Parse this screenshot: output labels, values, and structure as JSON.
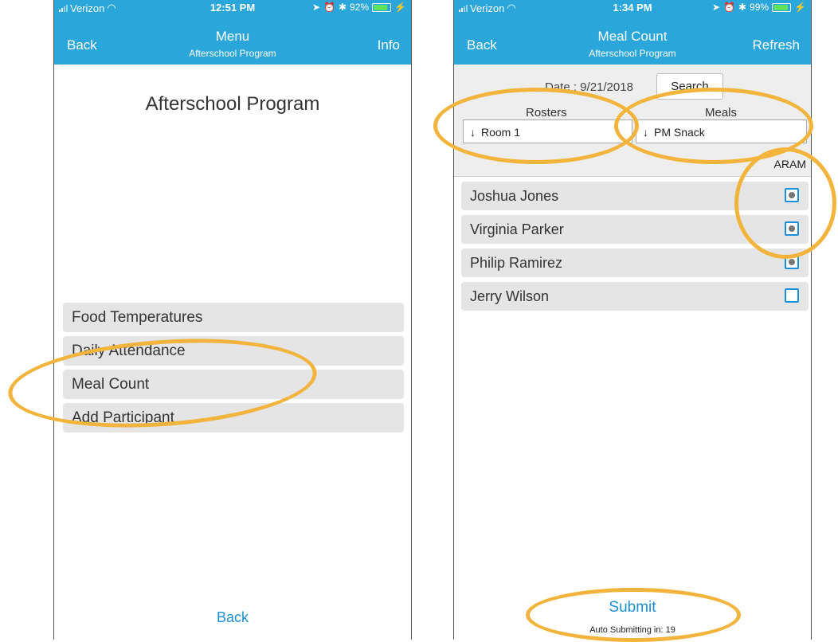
{
  "left_screen": {
    "status": {
      "carrier": "Verizon",
      "time": "12:51 PM",
      "battery": "92%",
      "battery_fill": 0.92
    },
    "nav": {
      "back": "Back",
      "title": "Menu",
      "subtitle": "Afterschool Program",
      "right": "Info"
    },
    "heading": "Afterschool Program",
    "menu_items": [
      "Food Temperatures",
      "Daily Attendance",
      "Meal Count",
      "Add Participant"
    ],
    "bottom_back": "Back"
  },
  "right_screen": {
    "status": {
      "carrier": "Verizon",
      "time": "1:34 PM",
      "battery": "99%",
      "battery_fill": 0.99
    },
    "nav": {
      "back": "Back",
      "title": "Meal Count",
      "subtitle": "Afterschool Program",
      "right": "Refresh"
    },
    "date_label": "Date : 9/21/2018",
    "search_label": "Search",
    "rosters_label": "Rosters",
    "meals_label": "Meals",
    "roster_value": "Room 1",
    "meal_value": "PM Snack",
    "dropdown_arrow": "↓",
    "column_header": "ARAM",
    "participants": [
      {
        "name": "Joshua Jones",
        "checked": true
      },
      {
        "name": "Virginia Parker",
        "checked": true
      },
      {
        "name": "Philip Ramirez",
        "checked": true
      },
      {
        "name": "Jerry Wilson",
        "checked": false
      }
    ],
    "submit": "Submit",
    "auto_submit": "Auto Submitting in: 19"
  },
  "colors": {
    "nav_blue": "#2aa6db",
    "link_blue": "#1b8fd8",
    "annotation_orange": "#f2b43c",
    "row_gray": "#e5e5e5"
  },
  "icons": [
    "signal-icon",
    "wifi-icon",
    "location-icon",
    "alarm-icon",
    "bluetooth-icon",
    "battery-icon",
    "charging-icon",
    "checkbox-icon"
  ]
}
